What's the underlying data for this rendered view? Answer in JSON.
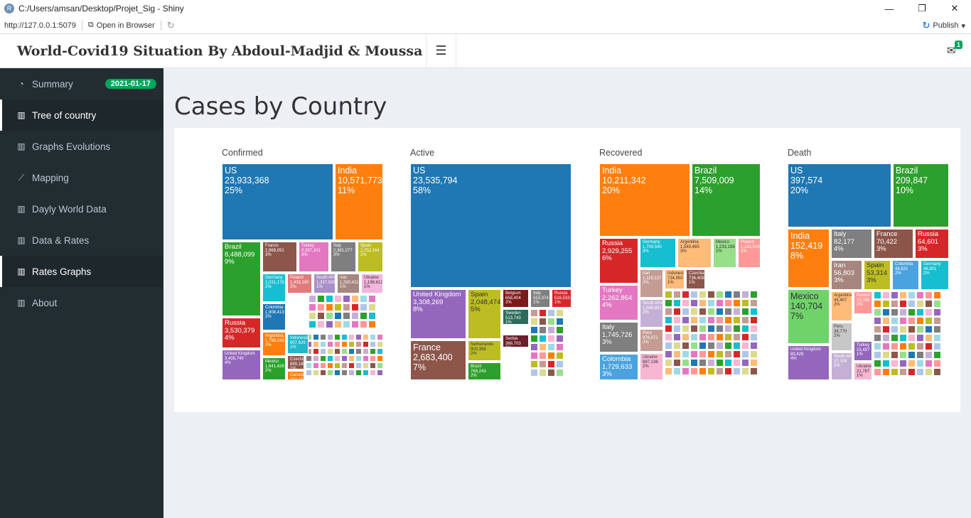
{
  "window": {
    "title": "C:/Users/amsan/Desktop/Projet_Sig - Shiny",
    "app_icon": "R",
    "minimize": "—",
    "restore": "❐",
    "close": "✕"
  },
  "addressbar": {
    "url": "http://127.0.0.1:5079",
    "open_browser": "Open in Browser",
    "publish": "Publish"
  },
  "header": {
    "brand": "World-Covid19 Situation By Abdoul-Madjid & Moussa",
    "menu_icon": "☰",
    "messages_count": "1"
  },
  "sidebar": {
    "items": [
      {
        "label": "Summary",
        "icon": "tachometer-icon",
        "badge": "2021-01-17"
      },
      {
        "label": "Tree of country",
        "icon": "bar-chart-icon",
        "active": true
      },
      {
        "label": "Graphs Evolutions",
        "icon": "bar-chart-icon"
      },
      {
        "label": "Mapping",
        "icon": "line-chart-icon"
      },
      {
        "label": "Dayly World Data",
        "icon": "bar-chart-icon"
      },
      {
        "label": "Data & Rates",
        "icon": "bar-chart-icon"
      },
      {
        "label": "Rates Graphs",
        "icon": "bar-chart-icon"
      },
      {
        "label": "About",
        "icon": "bar-chart-icon"
      }
    ]
  },
  "page": {
    "title": "Cases by Country"
  },
  "colors": {
    "blue": "#1f77b4",
    "orange": "#ff7f0e",
    "green": "#2ca02c",
    "red": "#d62728",
    "purple": "#9467bd",
    "brown": "#8c564b",
    "pink": "#e377c2",
    "gray": "#7f7f7f",
    "olive": "#bcbd22",
    "cyan": "#17becf"
  },
  "treemaps": [
    {
      "title": "Confirmed",
      "tiles": [
        {
          "country": "US",
          "value": "23,933,368",
          "pct": "25%"
        },
        {
          "country": "India",
          "value": "10,571,773",
          "pct": "11%"
        },
        {
          "country": "Brazil",
          "value": "8,488,099",
          "pct": "9%"
        },
        {
          "country": "Russia",
          "value": "3,530,379",
          "pct": "4%"
        },
        {
          "country": "United Kingdom",
          "value": "3,405,740",
          "pct": "4%"
        },
        {
          "country": "France",
          "value": "2,969,091",
          "pct": "3%"
        },
        {
          "country": "Turkey",
          "value": "2,387,101",
          "pct": "3%"
        },
        {
          "country": "Italy",
          "value": "2,381,277",
          "pct": "3%"
        },
        {
          "country": "Spain",
          "value": "2,252,164",
          "pct": "2%"
        },
        {
          "country": "Germany",
          "value": "2,031,178",
          "pct": "2%"
        },
        {
          "country": "Colombia",
          "value": "1,908,413",
          "pct": "2%"
        },
        {
          "country": "Argentina",
          "value": "1,799,243",
          "pct": "2%"
        },
        {
          "country": "Mexico",
          "value": "1,641,428",
          "pct": "2%"
        },
        {
          "country": "Poland",
          "value": "1,433,180",
          "pct": "2%"
        },
        {
          "country": "South Africa",
          "value": "1,337,926",
          "pct": "1%"
        },
        {
          "country": "Iran",
          "value": "1,330,411",
          "pct": "1%"
        },
        {
          "country": "Ukraine",
          "value": "1,198,612",
          "pct": "1%"
        },
        {
          "country": "Indonesia",
          "value": "907,929",
          "pct": "1%"
        },
        {
          "country": "Czechia",
          "value": "899,180",
          "pct": "1%"
        },
        {
          "country": "Canada",
          "value": "713,151",
          "pct": "1%"
        }
      ]
    },
    {
      "title": "Active",
      "tiles": [
        {
          "country": "US",
          "value": "23,535,794",
          "pct": "58%"
        },
        {
          "country": "United Kingdom",
          "value": "3,308,269",
          "pct": "8%"
        },
        {
          "country": "Spain",
          "value": "2,048,474",
          "pct": "5%"
        },
        {
          "country": "France",
          "value": "2,683,400",
          "pct": "7%"
        },
        {
          "country": "Netherlands",
          "value": "900,358",
          "pct": "2%"
        },
        {
          "country": "Belgium",
          "value": "658,404",
          "pct": "2%"
        },
        {
          "country": "Italy",
          "value": "553,374",
          "pct": "1%"
        },
        {
          "country": "Russia",
          "value": "516,533",
          "pct": "1%"
        },
        {
          "country": "Sweden",
          "value": "513,743",
          "pct": "1%"
        },
        {
          "country": "Serbia",
          "value": "368,703",
          "pct": "1%"
        },
        {
          "country": "Brazil",
          "value": "769,243",
          "pct": "2%"
        }
      ]
    },
    {
      "title": "Recovered",
      "tiles": [
        {
          "country": "India",
          "value": "10,211,342",
          "pct": "20%"
        },
        {
          "country": "Brazil",
          "value": "7,509,009",
          "pct": "14%"
        },
        {
          "country": "Russia",
          "value": "2,929,255",
          "pct": "6%"
        },
        {
          "country": "Turkey",
          "value": "2,262,864",
          "pct": "4%"
        },
        {
          "country": "Italy",
          "value": "1,745,726",
          "pct": "3%"
        },
        {
          "country": "Colombia",
          "value": "1,729,633",
          "pct": "3%"
        },
        {
          "country": "Germany",
          "value": "1,709,540",
          "pct": "3%"
        },
        {
          "country": "Argentina",
          "value": "1,583,465",
          "pct": "3%"
        },
        {
          "country": "Mexico",
          "value": "1,233,186",
          "pct": "2%"
        },
        {
          "country": "Poland",
          "value": "1,181,526",
          "pct": "2%"
        },
        {
          "country": "Iran",
          "value": "1,119,137",
          "pct": "2%"
        },
        {
          "country": "South Africa",
          "value": "1,088,801",
          "pct": "2%"
        },
        {
          "country": "Peru",
          "value": "978,072",
          "pct": "2%"
        },
        {
          "country": "Ukraine",
          "value": "897,136",
          "pct": "2%"
        },
        {
          "country": "Czechia",
          "value": "736,409",
          "pct": "1%"
        },
        {
          "country": "Indonesia",
          "value": "734,950",
          "pct": "1%"
        }
      ]
    },
    {
      "title": "Death",
      "tiles": [
        {
          "country": "US",
          "value": "397,574",
          "pct": "20%"
        },
        {
          "country": "Brazil",
          "value": "209,847",
          "pct": "10%"
        },
        {
          "country": "India",
          "value": "152,419",
          "pct": "8%"
        },
        {
          "country": "Mexico",
          "value": "140,704",
          "pct": "7%"
        },
        {
          "country": "United Kingdom",
          "value": "89,429",
          "pct": "4%"
        },
        {
          "country": "Italy",
          "value": "82,177",
          "pct": "4%"
        },
        {
          "country": "France",
          "value": "70,422",
          "pct": "3%"
        },
        {
          "country": "Russia",
          "value": "64,601",
          "pct": "3%"
        },
        {
          "country": "Iran",
          "value": "56,803",
          "pct": "3%"
        },
        {
          "country": "Spain",
          "value": "53,314",
          "pct": "3%"
        },
        {
          "country": "Colombia",
          "value": "48,631",
          "pct": "2%"
        },
        {
          "country": "Germany",
          "value": "46,901",
          "pct": "2%"
        },
        {
          "country": "Peru",
          "value": "38,770",
          "pct": "2%"
        },
        {
          "country": "Argentina",
          "value": "45,407",
          "pct": "2%"
        },
        {
          "country": "Poland",
          "value": "33,355",
          "pct": "2%"
        },
        {
          "country": "South Africa",
          "value": "37,105",
          "pct": "2%"
        },
        {
          "country": "Turkey",
          "value": "23,497",
          "pct": "1%"
        },
        {
          "country": "Ukraine",
          "value": "21,787",
          "pct": "1%"
        }
      ]
    }
  ]
}
